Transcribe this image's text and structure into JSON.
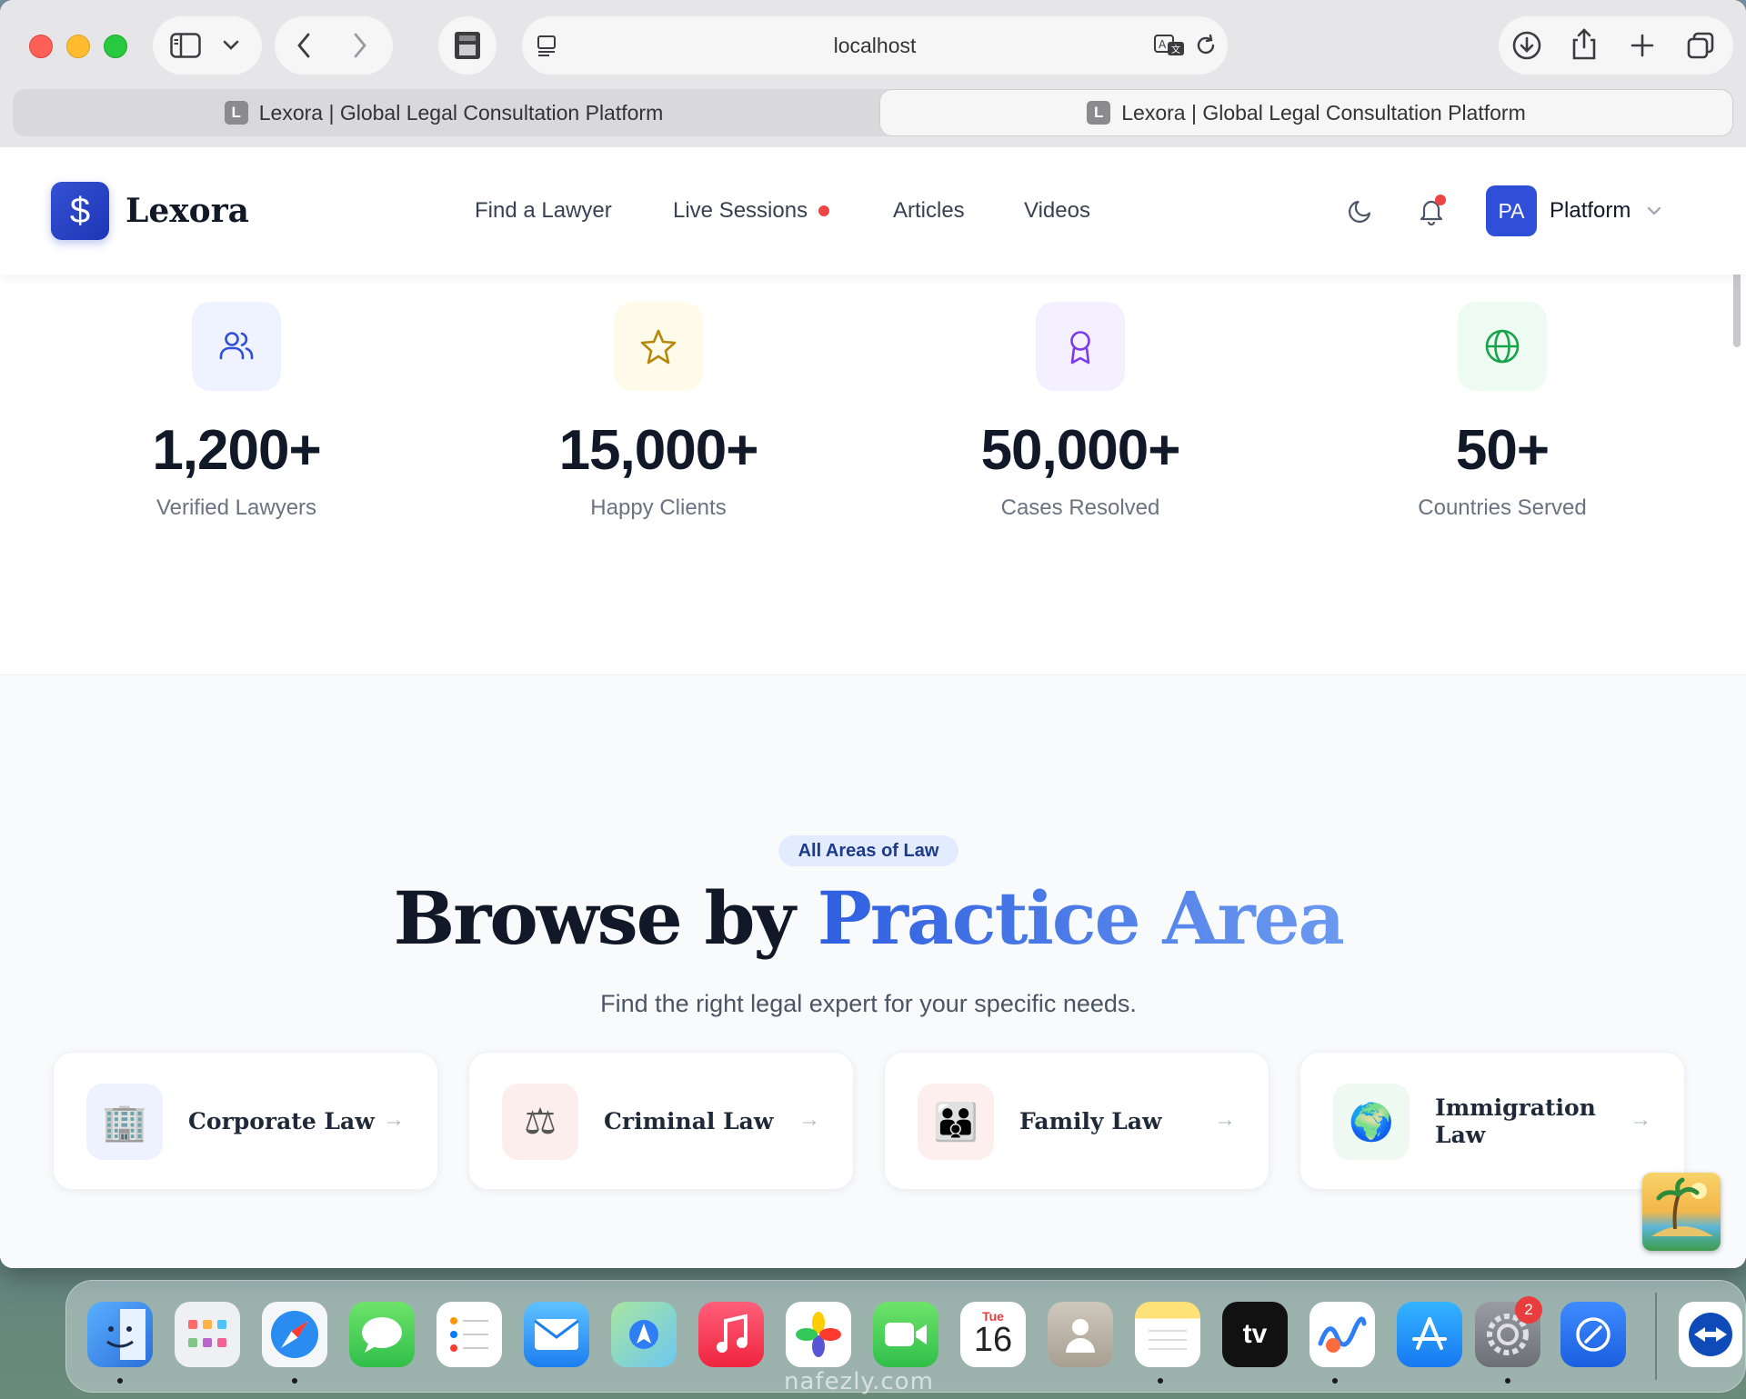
{
  "browser": {
    "url": "localhost",
    "tabs": [
      {
        "favicon": "L",
        "title": "Lexora | Global Legal Consultation Platform"
      },
      {
        "favicon": "L",
        "title": "Lexora | Global Legal Consultation Platform"
      }
    ],
    "icons": [
      "sidebar-icon",
      "chevron-down-icon",
      "back-icon",
      "forward-icon",
      "extension-icon",
      "reader-icon",
      "translate-icon",
      "reload-icon",
      "download-icon",
      "share-icon",
      "new-tab-icon",
      "tab-overview-icon"
    ]
  },
  "site": {
    "logo_symbol": "$",
    "brand": "Lexora",
    "nav": {
      "find_lawyer": "Find a Lawyer",
      "live_sessions": "Live Sessions",
      "articles": "Articles",
      "videos": "Videos"
    },
    "user": {
      "initials": "PA",
      "label": "Platform"
    },
    "colors": {
      "brand": "#2f4fd8",
      "live_dot": "#ef4444",
      "accent_gradient_start": "#2f5fe0",
      "accent_gradient_end": "#6c9af0"
    }
  },
  "stats": [
    {
      "icon": "users-icon",
      "value": "1,200+",
      "label": "Verified Lawyers",
      "icon_color": "#2f4fd8",
      "icon_bg": "#eef3ff"
    },
    {
      "icon": "star-icon",
      "value": "15,000+",
      "label": "Happy Clients",
      "icon_color": "#b8860b",
      "icon_bg": "#fffbeb"
    },
    {
      "icon": "award-icon",
      "value": "50,000+",
      "label": "Cases Resolved",
      "icon_color": "#7c3aed",
      "icon_bg": "#f5f0ff"
    },
    {
      "icon": "globe-icon",
      "value": "50+",
      "label": "Countries Served",
      "icon_color": "#16a34a",
      "icon_bg": "#eefbf2"
    }
  ],
  "practice": {
    "eyebrow": "All Areas of Law",
    "heading_plain": "Browse by ",
    "heading_accent": "Practice Area",
    "subheading": "Find the right legal expert for your specific needs.",
    "areas": [
      {
        "icon": "office-building-icon",
        "glyph": "🏢",
        "title": "Corporate Law",
        "icon_bg": "#eef2ff"
      },
      {
        "icon": "scales-icon",
        "glyph": "⚖",
        "title": "Criminal Law",
        "icon_bg": "#fdeeee"
      },
      {
        "icon": "family-icon",
        "glyph": "👪",
        "title": "Family Law",
        "icon_bg": "#fdefed"
      },
      {
        "icon": "earth-globe-icon",
        "glyph": "🌍",
        "title": "Immigration Law",
        "icon_bg": "#eefaf1"
      }
    ]
  },
  "dock": {
    "apps": [
      "Finder",
      "Launchpad",
      "Safari",
      "Messages",
      "Reminders",
      "Mail",
      "Maps",
      "Music",
      "Photos",
      "FaceTime",
      "Calendar",
      "Contacts",
      "Notes",
      "TV",
      "Freeform",
      "App Store",
      "System Settings",
      "Mirroring",
      "TeamViewer"
    ],
    "calendar_day": "Tue",
    "calendar_date": "16",
    "settings_badge": "2",
    "tv_label": "tv"
  },
  "watermark": "nafezly.com"
}
